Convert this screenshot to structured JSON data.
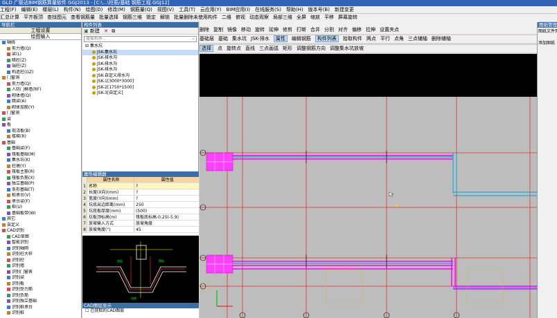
{
  "window": {
    "title": "GLD  广联达BIM钢筋算量软件 GGJ2013 - [C:\\...\\柱筋/基础 钢筋工程.GGJ12]"
  },
  "menu": [
    "工程(F)",
    "编辑(E)",
    "楼层(L)",
    "构件(N)",
    "绘图(D)",
    "修改(M)",
    "钢筋量(Q)",
    "视图(V)",
    "工具(T)",
    "云应用(Y)",
    "BIM应用(I)",
    "在线服务(S)",
    "帮助(H)",
    "版本号(B)",
    "新建变更"
  ],
  "toolbar1": [
    "汇总计算",
    "平齐板顶",
    "查找图元",
    "查看钢筋量",
    "批量选择",
    "钢筋三维",
    "锁定",
    "解锁",
    "批量删除未使用构件",
    "二维",
    "俯视",
    "动态观察",
    "局部三维",
    "全屏",
    "缩放",
    "平移",
    "屏幕旋转"
  ],
  "toolbar2": [
    "删除",
    "复制",
    "镜像",
    "移动",
    "旋转",
    "延伸",
    "修剪",
    "打断",
    "合并",
    "分割",
    "对齐",
    "偏移",
    "拉伸",
    "设置夹点"
  ],
  "toolbar3": [
    "基础层",
    "基础",
    "集水坑",
    "JSK-排水",
    "属性",
    "编辑钢筋",
    "构件列表",
    "拾取构件",
    "两点",
    "平行",
    "点角",
    "三点辅轴",
    "删除辅轴"
  ],
  "toolbar4": [
    "选择",
    "点",
    "旋转点",
    "直线",
    "三点画弧",
    "矩形",
    "调整钢筋方向",
    "调整集水坑放坡"
  ],
  "nav": {
    "tabs": [
      "工程设置",
      "绘图输入"
    ],
    "items": [
      "轴线",
      "剪力墙(Q)",
      "梁(L)",
      "暗柱(Z)",
      "端柱(Z)",
      "构造柱(GZ)",
      "门窗洞",
      "剪力墙(Q)",
      "人防门框墙(RF)",
      "砌体墙(Q)",
      "暗梁(A)",
      "砌体加筋(Y)",
      "门窗洞",
      "梁",
      "板",
      "现浇板(B)",
      "楼梯(R)",
      "基础",
      "基础梁(F)",
      "筏板基础(M)",
      "集水坑(K)",
      "柱墩(Y)",
      "筏板主筋(R)",
      "筏板负筋(X)",
      "独立基础(P)",
      "条形基础(T)",
      "桩承台(V)",
      "承台梁(F)",
      "桩(U)",
      "基础板带(W)",
      "其它",
      "自定义",
      "CAD识别",
      "CAD草图",
      "智能识别",
      "识别轴网",
      "识别柱大样",
      "识别柱",
      "识别墙",
      "识别门窗表",
      "识别梁",
      "识别板",
      "识别受力筋",
      "识别负筋",
      "识别独立基础",
      "识别桩承台",
      "识别桩"
    ]
  },
  "component_list": {
    "header": "构件列表",
    "new_label": "新建",
    "search_placeholder": "搜索构件...",
    "root": "集水坑",
    "items": [
      "JSK-集水坑",
      "JSK-排水沟",
      "JSK-排水沟",
      "JSK-排水沟",
      "JSK-自定义排水沟",
      "JSK-1[3000*3000]",
      "JSK-2[1750*1500]",
      "JSK-3[自定义]"
    ]
  },
  "properties": {
    "header": "属性编辑器",
    "col_name": "属性名称",
    "col_value": "属性值",
    "rows": [
      {
        "n": "1",
        "name": "名称",
        "value": "?"
      },
      {
        "n": "2",
        "name": "长度(X向)(mm)",
        "value": "?"
      },
      {
        "n": "3",
        "name": "宽度(Y向)(mm)",
        "value": "?"
      },
      {
        "n": "4",
        "name": "坑底出边距离(mm)",
        "value": "250"
      },
      {
        "n": "5",
        "name": "坑底板厚度(mm)",
        "value": "(500)"
      },
      {
        "n": "6",
        "name": "坑板顶标高(m)",
        "value": "筏板底标高-0.25(-5.9)"
      },
      {
        "n": "7",
        "name": "放坡输入方式",
        "value": "放坡角度"
      },
      {
        "n": "8",
        "name": "放坡角度(°)",
        "value": "45"
      }
    ]
  },
  "cad_panel": {
    "header": "CAD图层显示",
    "items": [
      "已提取的CAD图层",
      "CAD原始图层"
    ]
  },
  "right_panel": {
    "header": "图纸管理",
    "items": [
      "图纸文件列表",
      "添加图纸"
    ]
  },
  "colors": {
    "accent": "#3a6ea5",
    "magenta": "#ff00ff",
    "axis_red": "#e03030",
    "cyan": "#00a0e0"
  }
}
